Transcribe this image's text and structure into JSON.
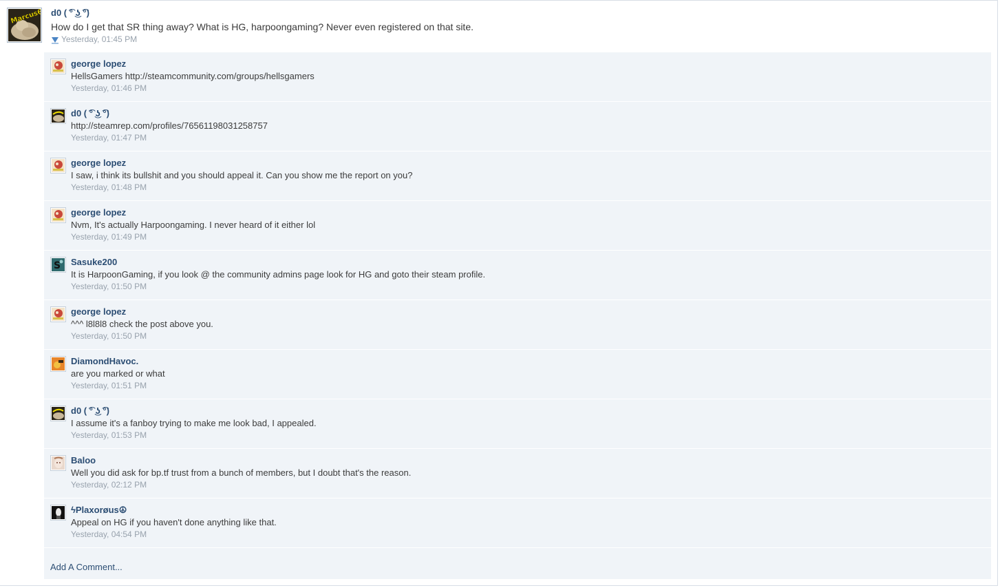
{
  "post": {
    "username": "d0 ( ͡° ͜ʖ ͡°)",
    "message": "How do I get that SR thing away? What is HG, harpoongaming? Never even registered on that site.",
    "timestamp": "Yesterday, 01:45 PM",
    "avatar_text": "Marcus66"
  },
  "comments": [
    {
      "username": "george lopez",
      "message": "HellsGamers http://steamcommunity.com/groups/hellsgamers",
      "timestamp": "Yesterday, 01:46 PM",
      "avatar": "george-lopez-avatar"
    },
    {
      "username": "d0 ( ͡° ͜ʖ ͡°)",
      "message": "http://steamrep.com/profiles/76561198031258757",
      "timestamp": "Yesterday, 01:47 PM",
      "avatar": "d0-avatar"
    },
    {
      "username": "george lopez",
      "message": "I saw, i think its bullshit and you should appeal it. Can you show me the report on you?",
      "timestamp": "Yesterday, 01:48 PM",
      "avatar": "george-lopez-avatar"
    },
    {
      "username": "george lopez",
      "message": "Nvm, It's actually Harpoongaming. I never heard of it either lol",
      "timestamp": "Yesterday, 01:49 PM",
      "avatar": "george-lopez-avatar"
    },
    {
      "username": "Sasuke200",
      "message": "It is HarpoonGaming, if you look @ the community admins page look for HG and goto their steam profile.",
      "timestamp": "Yesterday, 01:50 PM",
      "avatar": "sasuke-avatar"
    },
    {
      "username": "george lopez",
      "message": "^^^ l8l8l8 check the post above you.",
      "timestamp": "Yesterday, 01:50 PM",
      "avatar": "george-lopez-avatar"
    },
    {
      "username": "DiamondHavoc.",
      "message": "are you marked or what",
      "timestamp": "Yesterday, 01:51 PM",
      "avatar": "diamondhavoc-avatar"
    },
    {
      "username": "d0 ( ͡° ͜ʖ ͡°)",
      "message": "I assume it's a fanboy trying to make me look bad, I appealed.",
      "timestamp": "Yesterday, 01:53 PM",
      "avatar": "d0-avatar"
    },
    {
      "username": "Baloo",
      "message": "Well you did ask for bp.tf trust from a bunch of members, but I doubt that's the reason.",
      "timestamp": "Yesterday, 02:12 PM",
      "avatar": "baloo-avatar"
    },
    {
      "username": "ϟPlaxorøus☮",
      "message": "Appeal on HG if you haven't done anything like that.",
      "timestamp": "Yesterday, 04:54 PM",
      "avatar": "plaxoraus-avatar"
    }
  ],
  "add_comment_label": "Add A Comment...",
  "colors": {
    "link": "#2b4d73",
    "panel_bg": "#f0f4f8",
    "timestamp": "#98a2ad"
  }
}
